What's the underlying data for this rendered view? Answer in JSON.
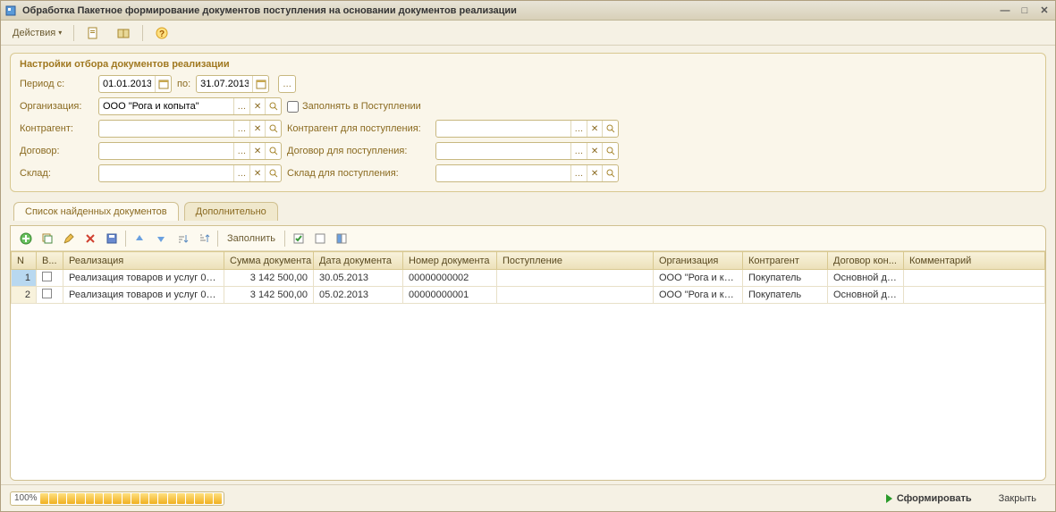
{
  "window": {
    "title": "Обработка  Пакетное формирование документов поступления на основании документов реализации"
  },
  "toolbar": {
    "actions_label": "Действия"
  },
  "filter": {
    "title": "Настройки отбора документов реализации",
    "period_label": "Период с:",
    "period_from": "01.01.2013",
    "period_to_label": "по:",
    "period_to": "31.07.2013",
    "org_label": "Организация:",
    "org_value": "ООО \"Рога и копыта\"",
    "fill_in_receipt_label": "Заполнять в Поступлении",
    "contragent_label": "Контрагент:",
    "contragent_value": "",
    "contragent_recv_label": "Контрагент для поступления:",
    "contragent_recv_value": "",
    "contract_label": "Договор:",
    "contract_value": "",
    "contract_recv_label": "Договор для поступления:",
    "contract_recv_value": "",
    "warehouse_label": "Склад:",
    "warehouse_value": "",
    "warehouse_recv_label": "Склад для поступления:",
    "warehouse_recv_value": ""
  },
  "tabs": {
    "found": "Список найденных документов",
    "additional": "Дополнительно"
  },
  "gridbar": {
    "fill_label": "Заполнить"
  },
  "columns": {
    "n": "N",
    "v": "В...",
    "realization": "Реализация",
    "sum": "Сумма документа",
    "date": "Дата документа",
    "number": "Номер документа",
    "receipt": "Поступление",
    "org": "Организация",
    "contragent": "Контрагент",
    "contract": "Договор кон...",
    "comment": "Комментарий"
  },
  "rows": [
    {
      "n": "1",
      "realization": "Реализация товаров и услуг 00...",
      "sum": "3 142 500,00",
      "date": "30.05.2013",
      "number": "00000000002",
      "receipt": "",
      "org": "ООО \"Рога и ко...",
      "contragent": "Покупатель",
      "contract": "Основной до...",
      "comment": ""
    },
    {
      "n": "2",
      "realization": "Реализация товаров и услуг 00...",
      "sum": "3 142 500,00",
      "date": "05.02.2013",
      "number": "00000000001",
      "receipt": "",
      "org": "ООО \"Рога и ко...",
      "contragent": "Покупатель",
      "contract": "Основной до...",
      "comment": ""
    }
  ],
  "footer": {
    "progress_label": "100%",
    "form_button": "Сформировать",
    "close_button": "Закрыть"
  }
}
